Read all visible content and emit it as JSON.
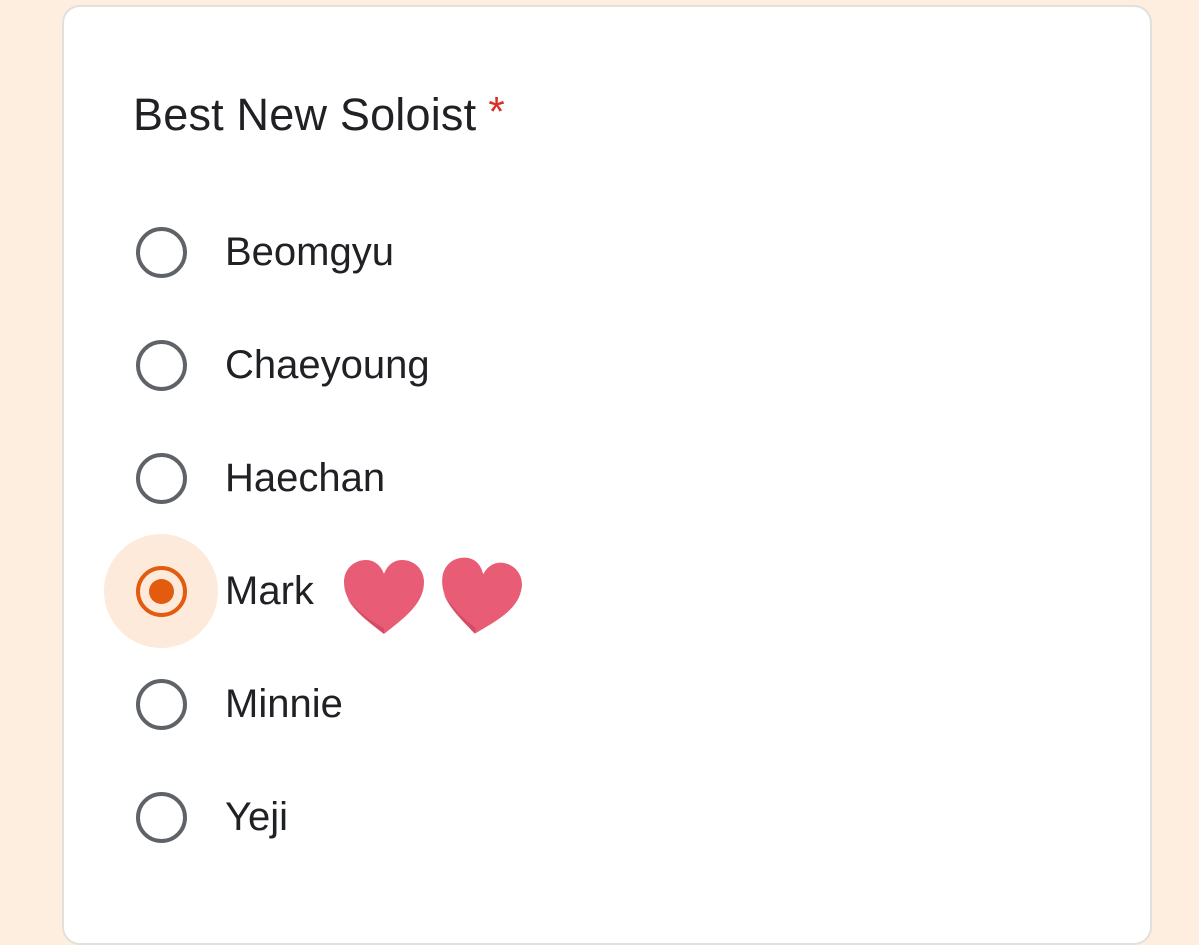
{
  "form": {
    "question": {
      "title": "Best New Soloist",
      "required_marker": "*"
    },
    "options": [
      {
        "label": "Beomgyu",
        "selected": false
      },
      {
        "label": "Chaeyoung",
        "selected": false
      },
      {
        "label": "Haechan",
        "selected": false
      },
      {
        "label": "Mark",
        "selected": true
      },
      {
        "label": "Minnie",
        "selected": false
      },
      {
        "label": "Yeji",
        "selected": false
      }
    ],
    "decoration": {
      "icon": "heart-icon",
      "count": 2
    }
  },
  "colors": {
    "page_background": "#fdeee0",
    "accent": "#e25b0f",
    "required": "#d93025",
    "heart": "#e85d75",
    "text": "#202124",
    "radio_unselected": "#5f6368"
  }
}
